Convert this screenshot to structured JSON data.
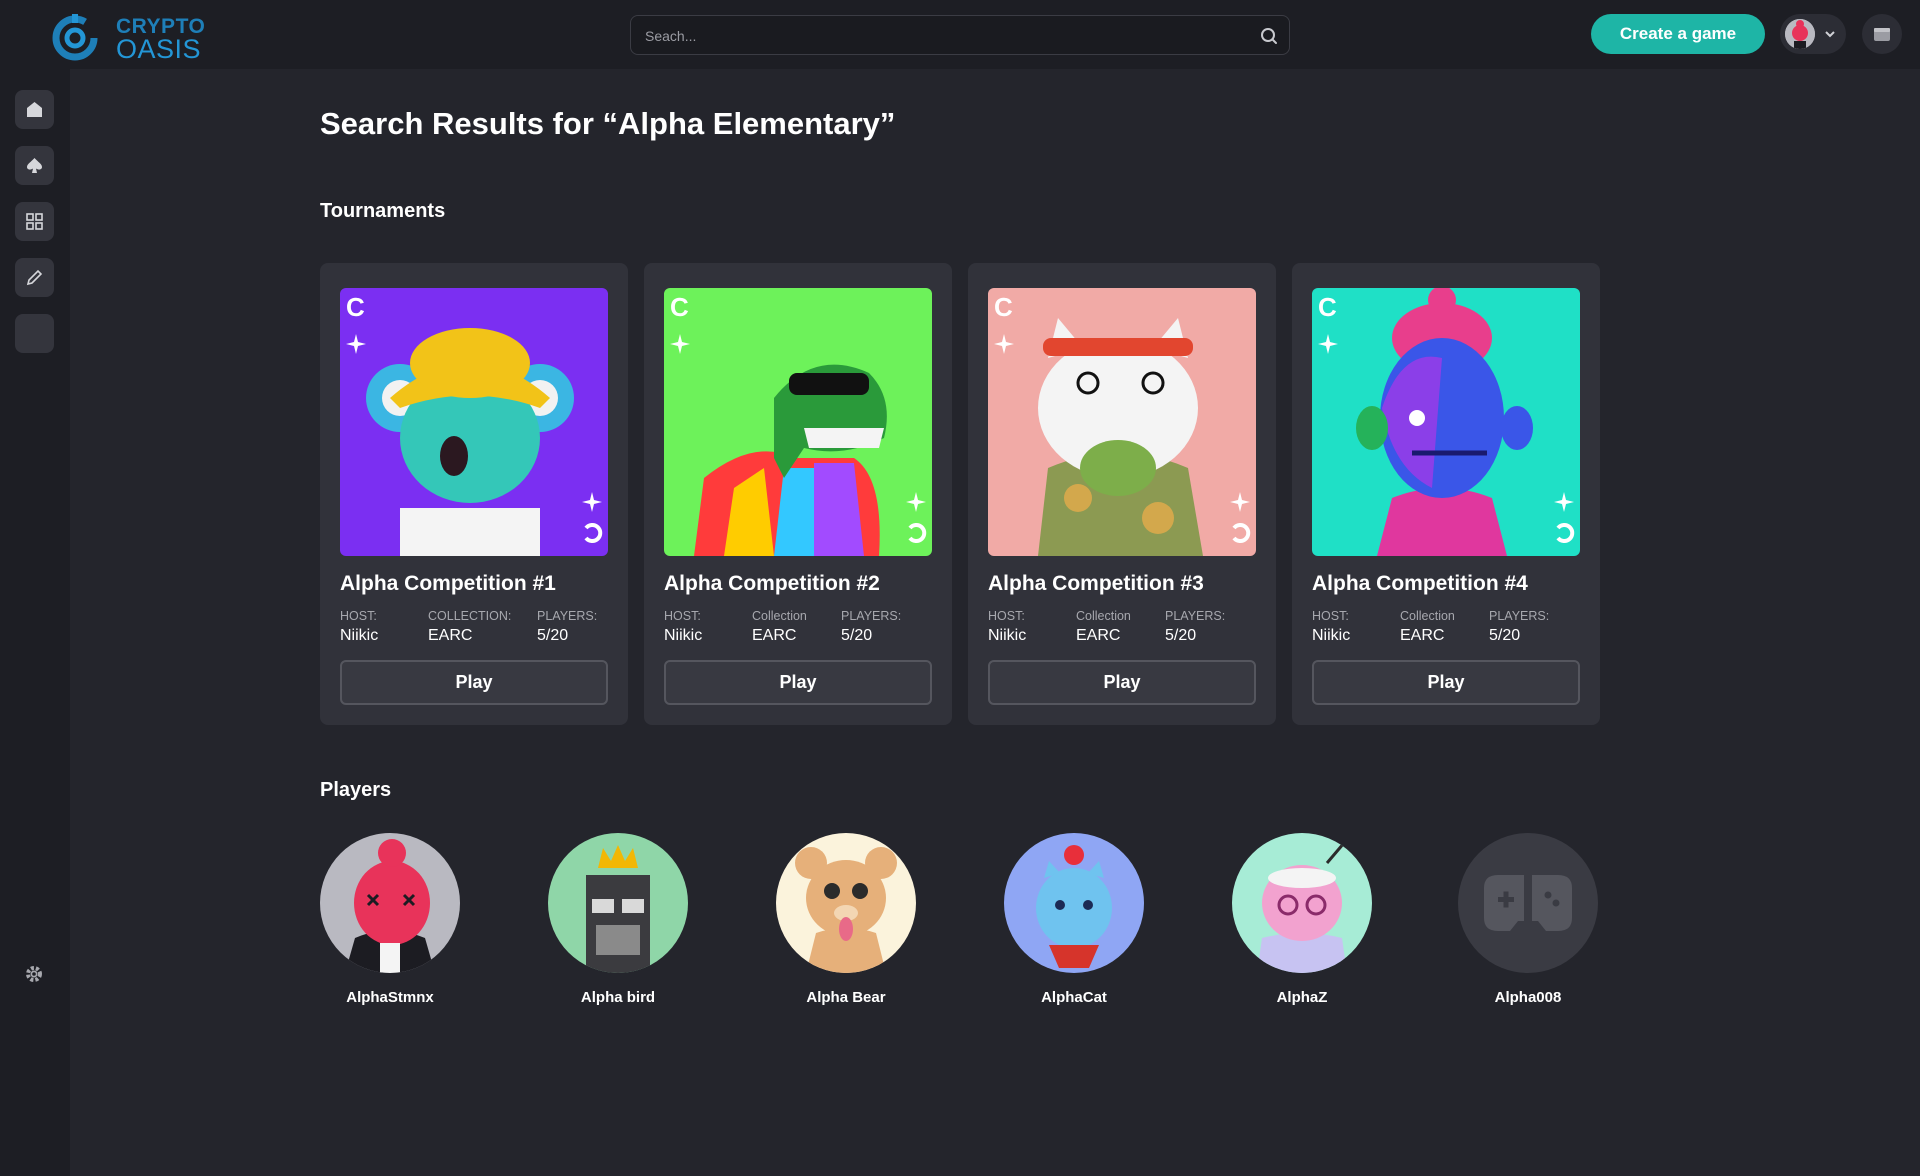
{
  "brand": {
    "line1": "CRYPTO",
    "line2": "OASIS",
    "primary_color": "#1e7fb8",
    "accent_color": "#2396d6"
  },
  "search": {
    "placeholder": "Seach..."
  },
  "header": {
    "create_label": "Create a game",
    "create_color": "#1eb5a6"
  },
  "sidebar": {
    "items": [
      {
        "icon": "home-icon"
      },
      {
        "icon": "spade-icon"
      },
      {
        "icon": "grid-icon"
      },
      {
        "icon": "pencil-icon"
      },
      {
        "icon": "blank"
      }
    ],
    "settings_icon": "gear-icon"
  },
  "page": {
    "title": "Search Results for “Alpha Elementary”"
  },
  "tournaments": {
    "title": "Tournaments",
    "cards": [
      {
        "name": "Alpha Competition #1",
        "host_label": "HOST:",
        "host": "Niikic",
        "collection_label": "COLLECTION:",
        "collection": "EARC",
        "players_label": "PLAYERS:",
        "players": "5/20",
        "play_label": "Play",
        "bg_color": "#7b2ff2"
      },
      {
        "name": "Alpha Competition #2",
        "host_label": "HOST:",
        "host": "Niikic",
        "collection_label": "Collection",
        "collection": "EARC",
        "players_label": "PLAYERS:",
        "players": "5/20",
        "play_label": "Play",
        "bg_color": "#6df25a"
      },
      {
        "name": "Alpha Competition #3",
        "host_label": "HOST:",
        "host": "Niikic",
        "collection_label": "Collection",
        "collection": "EARC",
        "players_label": "PLAYERS:",
        "players": "5/20",
        "play_label": "Play",
        "bg_color": "#f1aaa6"
      },
      {
        "name": "Alpha Competition #4",
        "host_label": "HOST:",
        "host": "Niikic",
        "collection_label": "Collection",
        "collection": "EARC",
        "players_label": "PLAYERS:",
        "players": "5/20",
        "play_label": "Play",
        "bg_color": "#1fe0c6"
      }
    ]
  },
  "players": {
    "title": "Players",
    "list": [
      {
        "name": "AlphaStmnx",
        "bg_color": "#b9b9c1"
      },
      {
        "name": "Alpha bird",
        "bg_color": "#8fd6a8"
      },
      {
        "name": "Alpha Bear",
        "bg_color": "#fbf3dc"
      },
      {
        "name": "AlphaCat",
        "bg_color": "#8fa6f4"
      },
      {
        "name": "AlphaZ",
        "bg_color": "#a7ecd6"
      },
      {
        "name": "Alpha008",
        "bg_color": "#3a3b43"
      }
    ]
  }
}
